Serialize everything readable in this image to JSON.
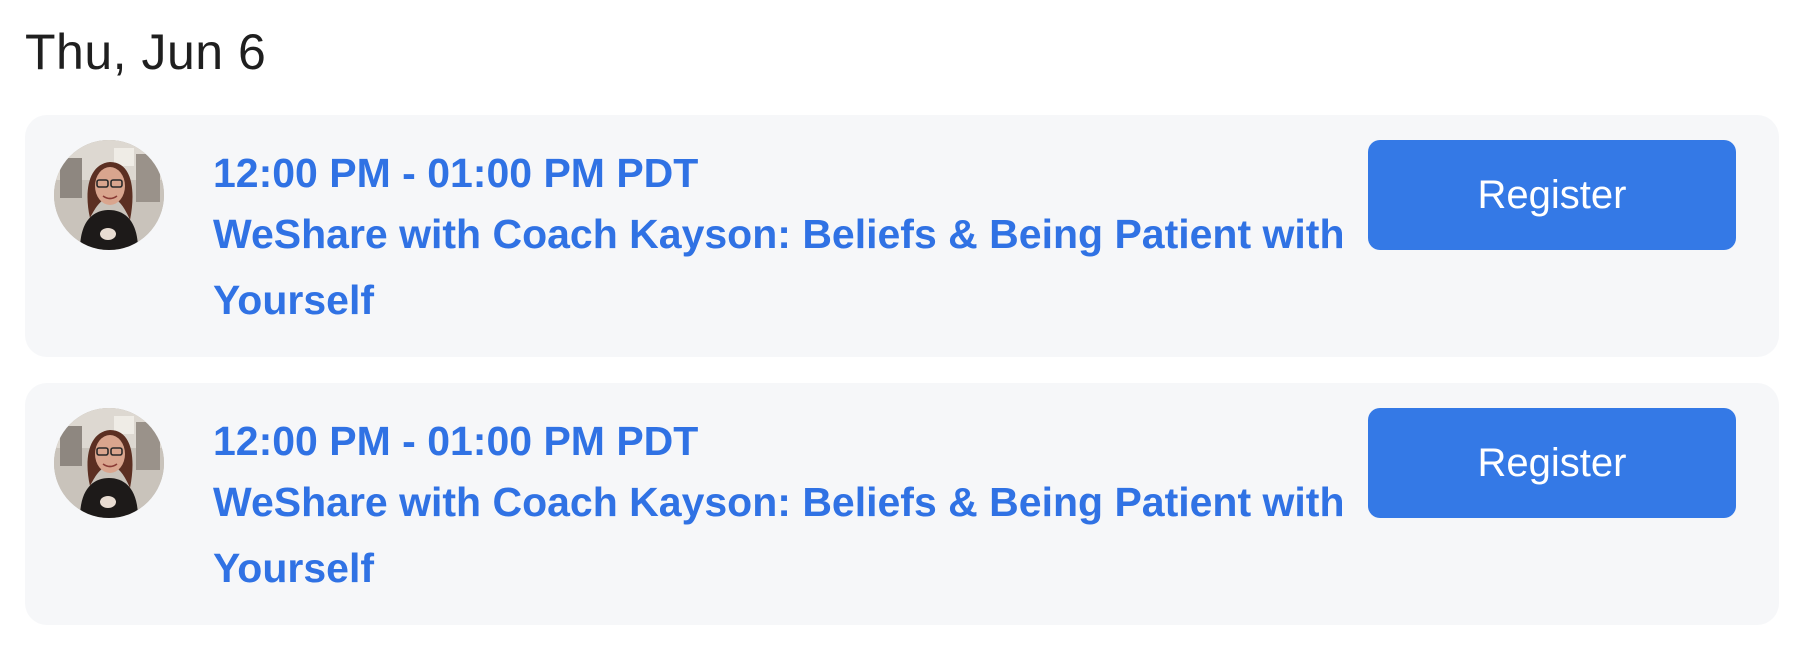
{
  "date_heading": "Thu, Jun 6",
  "sessions": [
    {
      "time": "12:00 PM - 01:00 PM PDT",
      "title": "WeShare with Coach Kayson: Beliefs & Being Patient with Yourself",
      "button_label": "Register",
      "avatar_icon": "host-avatar-photo"
    },
    {
      "time": "12:00 PM - 01:00 PM PDT",
      "title": "WeShare with Coach Kayson: Beliefs & Being Patient with Yourself",
      "button_label": "Register",
      "avatar_icon": "host-avatar-photo"
    }
  ],
  "colors": {
    "accent_text": "#3072e4",
    "button_bg": "#3479e6",
    "card_bg": "#f6f7f9",
    "heading_text": "#1f1f1f"
  }
}
